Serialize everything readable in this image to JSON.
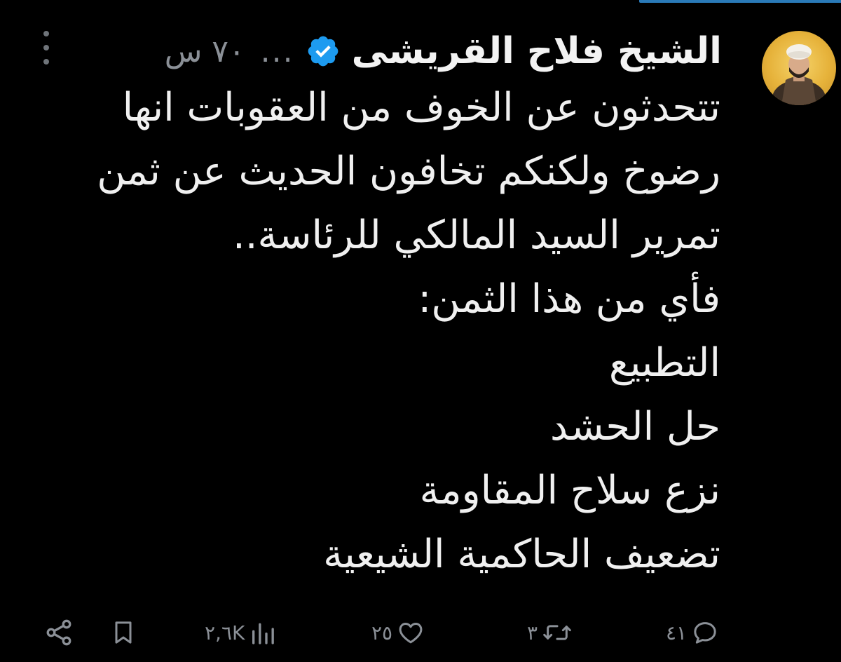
{
  "tweet": {
    "author": {
      "display_name": "الشيخ فلاح القريشى",
      "handle": "...",
      "verified": true,
      "avatar_icon": "user-avatar-icon"
    },
    "timestamp": "٧٠ س",
    "body_lines": [
      "تتحدثون عن الخوف من العقوبات انها",
      "رضوخ ولكنكم تخافون الحديث عن ثمن",
      "تمرير السيد المالكي للرئاسة..",
      "فأي من هذا الثمن:",
      "التطبيع",
      "حل الحشد",
      "نزع سلاح المقاومة",
      "تضعيف الحاكمية الشيعية"
    ],
    "actions": {
      "reply_count": "٤١",
      "retweet_count": "٣",
      "like_count": "٢٥",
      "views_count": "٢,٦K"
    }
  },
  "colors": {
    "background": "#000000",
    "text": "#e7e9ea",
    "muted": "#8b9097",
    "verified": "#1d9bf0"
  }
}
